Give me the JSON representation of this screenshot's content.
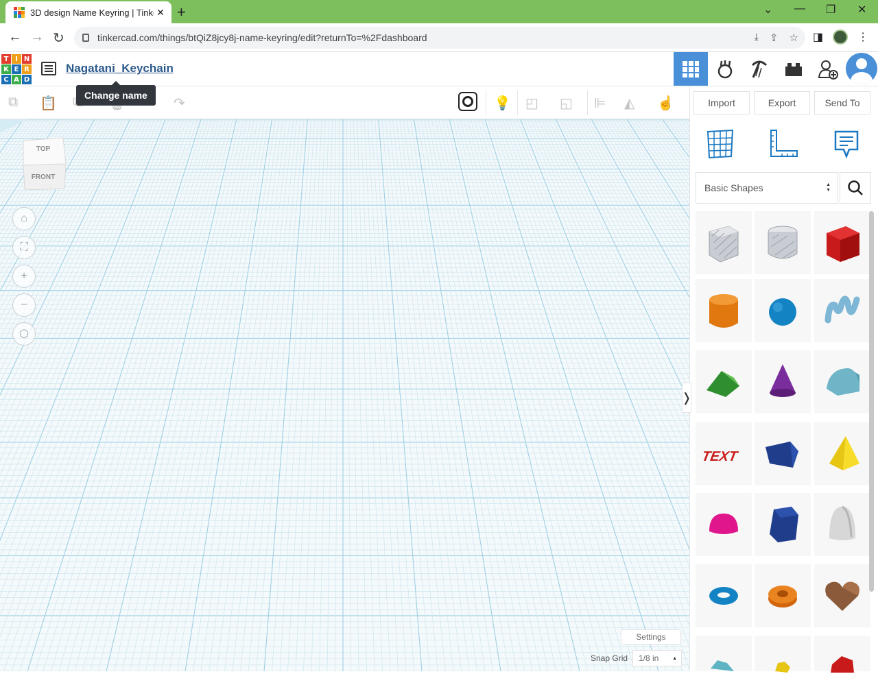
{
  "browser": {
    "tab_title": "3D design Name Keyring | Tinke",
    "url": "tinkercad.com/things/btQiZ8jcy8j-name-keyring/edit?returnTo=%2Fdashboard"
  },
  "header": {
    "logo_letters": [
      "T",
      "I",
      "N",
      "K",
      "E",
      "R",
      "C",
      "A",
      "D"
    ],
    "design_name": "Nagatani_Keychain",
    "tooltip": "Change name"
  },
  "panel": {
    "import_label": "Import",
    "export_label": "Export",
    "sendto_label": "Send To",
    "library": "Basic Shapes",
    "shapes": [
      "box-hole-shape",
      "cylinder-hole-shape",
      "box-shape",
      "cylinder-shape",
      "sphere-shape",
      "scribble-shape",
      "roof-shape",
      "cone-shape",
      "round-roof-shape",
      "text-shape",
      "polygon-shape",
      "pyramid-shape",
      "half-sphere-shape",
      "hexagonal-prism-shape",
      "paraboloid-shape",
      "torus-shape",
      "tube-shape",
      "heart-shape",
      "star-shape-partial",
      "star-shape-yellow-partial",
      "icosahedron-shape-partial"
    ],
    "text_shape_label": "TEXT"
  },
  "workplane": {
    "viewcube_top": "TOP",
    "viewcube_front": "FRONT",
    "settings_label": "Settings",
    "snap_grid_label": "Snap Grid",
    "snap_grid_value": "1/8 in"
  },
  "colors": {
    "accent": "#4a90d9",
    "chrome_frame": "#7dbf5d",
    "grid_major": "#9fd0e3",
    "grid_minor": "#cfe6ef"
  }
}
